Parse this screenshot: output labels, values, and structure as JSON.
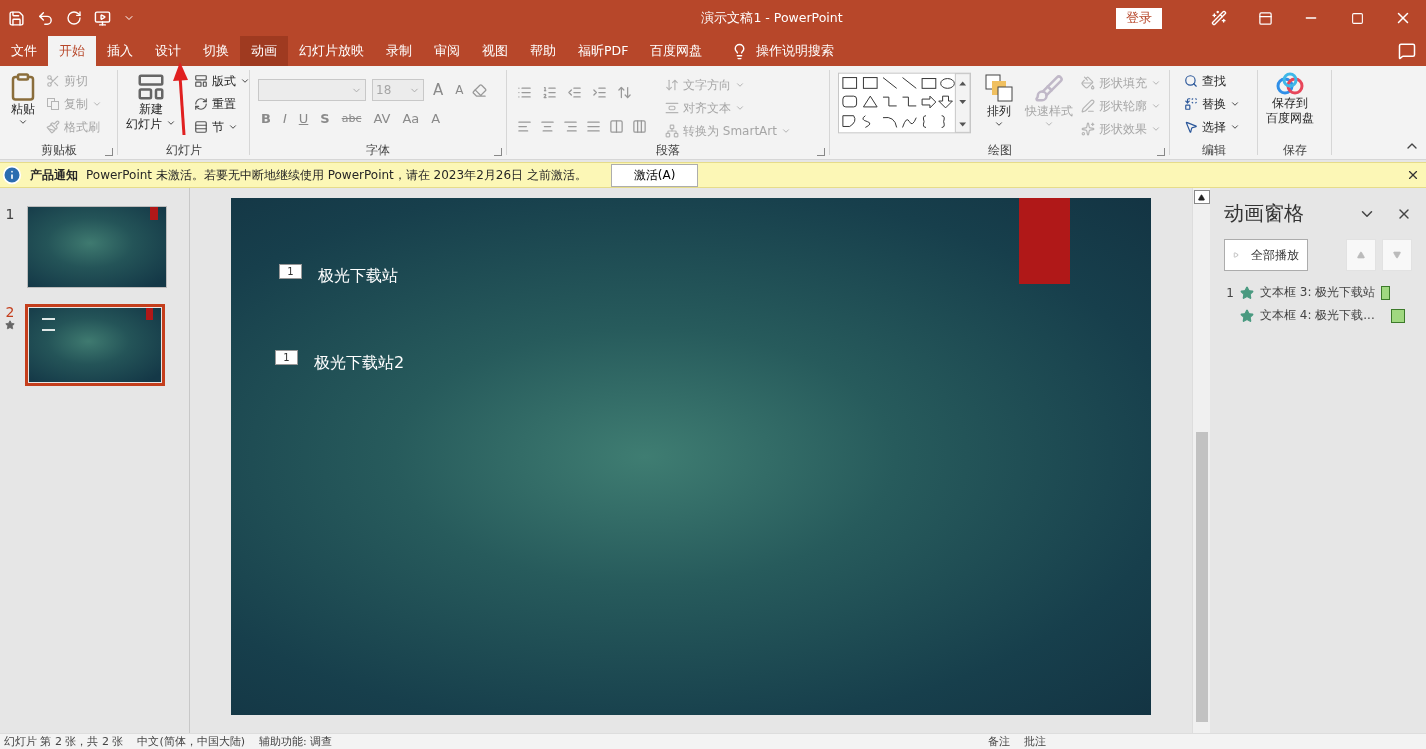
{
  "window": {
    "title": "演示文稿1  -  PowerPoint",
    "sign_in": "登录"
  },
  "tabs": [
    {
      "label": "文件",
      "selected": false,
      "hovered": false
    },
    {
      "label": "开始",
      "selected": true,
      "hovered": false
    },
    {
      "label": "插入",
      "selected": false,
      "hovered": false
    },
    {
      "label": "设计",
      "selected": false,
      "hovered": false
    },
    {
      "label": "切换",
      "selected": false,
      "hovered": false
    },
    {
      "label": "动画",
      "selected": false,
      "hovered": true
    },
    {
      "label": "幻灯片放映",
      "selected": false,
      "hovered": false
    },
    {
      "label": "录制",
      "selected": false,
      "hovered": false
    },
    {
      "label": "审阅",
      "selected": false,
      "hovered": false
    },
    {
      "label": "视图",
      "selected": false,
      "hovered": false
    },
    {
      "label": "帮助",
      "selected": false,
      "hovered": false
    },
    {
      "label": "福昕PDF",
      "selected": false,
      "hovered": false
    },
    {
      "label": "百度网盘",
      "selected": false,
      "hovered": false
    }
  ],
  "tell_me": "操作说明搜索",
  "ribbon": {
    "clipboard": {
      "label": "剪贴板",
      "paste": "粘贴",
      "items": [
        {
          "label": "剪切",
          "disabled": true
        },
        {
          "label": "复制",
          "disabled": true
        },
        {
          "label": "格式刷",
          "disabled": true
        }
      ]
    },
    "slides": {
      "label": "幻灯片",
      "new_slide": [
        "新建",
        "幻灯片"
      ],
      "items": [
        {
          "label": "版式",
          "disabled": false
        },
        {
          "label": "重置",
          "disabled": false
        },
        {
          "label": "节",
          "disabled": false
        }
      ]
    },
    "font": {
      "label": "字体",
      "font_size": "18",
      "size_buttons": [
        "A",
        "A"
      ],
      "format_buttons": [
        "B",
        "I",
        "U",
        "S",
        "abc",
        "AV",
        "Aa",
        "A"
      ]
    },
    "paragraph": {
      "label": "段落",
      "items": [
        {
          "label": "文字方向",
          "disabled": true
        },
        {
          "label": "对齐文本",
          "disabled": true
        },
        {
          "label": "转换为 SmartArt",
          "disabled": true
        }
      ]
    },
    "drawing": {
      "label": "绘图",
      "arrange": "排列",
      "quick_styles": {
        "label": "快速样式",
        "disabled": true
      },
      "items": [
        {
          "label": "形状填充",
          "disabled": true
        },
        {
          "label": "形状轮廓",
          "disabled": true
        },
        {
          "label": "形状效果",
          "disabled": true
        }
      ]
    },
    "editing": {
      "label": "编辑",
      "items": [
        {
          "label": "查找",
          "disabled": false
        },
        {
          "label": "替换",
          "disabled": false
        },
        {
          "label": "选择",
          "disabled": false
        }
      ]
    },
    "save": {
      "label": "保存",
      "button": [
        "保存到",
        "百度网盘"
      ]
    }
  },
  "notice": {
    "title": "产品通知",
    "message": "PowerPoint 未激活。若要无中断地继续使用 PowerPoint，请在 2023年2月26日 之前激活。",
    "button": "激活(A)"
  },
  "thumbnails": [
    {
      "number": "1",
      "selected": false,
      "animated": false,
      "shows_text": false
    },
    {
      "number": "2",
      "selected": true,
      "animated": true,
      "shows_text": true
    }
  ],
  "slide": {
    "text_boxes": [
      {
        "tag": "1",
        "text": "极光下载站"
      },
      {
        "tag": "1",
        "text": "极光下载站2"
      }
    ]
  },
  "animation_pane": {
    "title": "动画窗格",
    "play_all": "全部播放",
    "items": [
      {
        "number": "1",
        "label": "文本框 3: 极光下载站",
        "color": "#a0d880"
      },
      {
        "label": "文本框 4: 极光下载...",
        "color": "#a0d880"
      }
    ]
  },
  "status_bar": {
    "slide_info": "幻灯片 第 2 张，共 2 张",
    "language": "中文(简体，中国大陆)",
    "accessibility": "辅助功能: 调查",
    "notes": "备注",
    "comments": "批注"
  }
}
